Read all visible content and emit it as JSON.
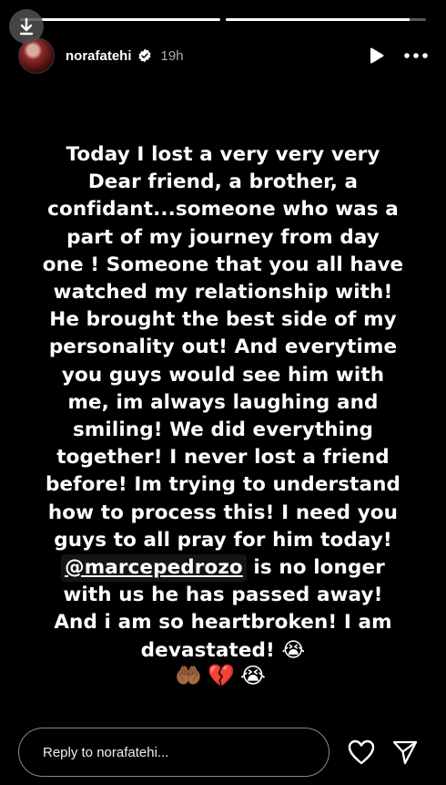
{
  "story": {
    "progress": [
      1.0,
      0.92
    ],
    "header": {
      "username": "norafatehi",
      "time": "19h"
    },
    "text_lines": [
      "Today I lost a very very very",
      "Dear friend, a brother, a",
      "confidant...someone who was a",
      "part of my journey from day",
      "one ! Someone that you all have",
      "watched my relationship with!",
      "He brought the best side of my",
      "personality out! And everytime",
      "you guys would see him with",
      "me, im always laughing and",
      "smiling! We did everything",
      "together! I never lost a friend",
      "before! Im trying to understand",
      "how to process this! I need you",
      "guys to all pray for him today!"
    ],
    "mention": "@marcepedrozo",
    "after_mention": " is no longer",
    "text_lines_2": [
      "with us he has passed away!",
      "And i am so heartbroken! I am"
    ],
    "last_line": "devastated!",
    "last_emoji": "😭",
    "emoji_row": "🤲🏾💔😭"
  },
  "footer": {
    "reply_placeholder": "Reply to norafatehi..."
  }
}
